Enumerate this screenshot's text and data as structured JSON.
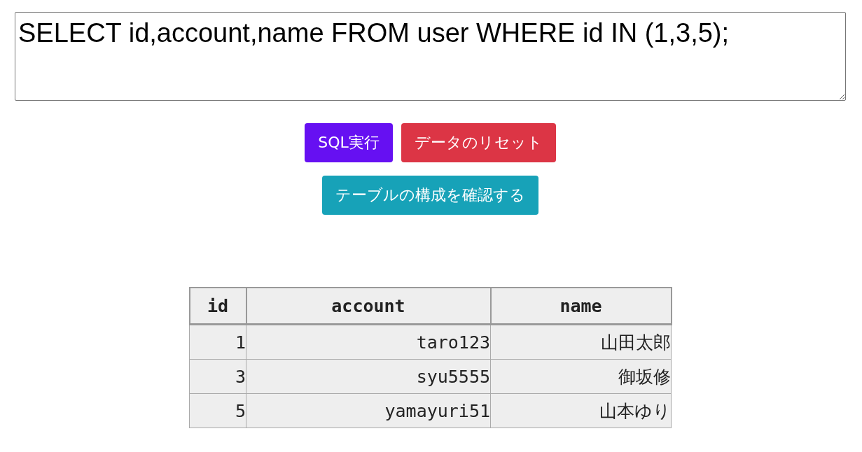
{
  "query": {
    "value": "SELECT id,account,name FROM user WHERE id IN (1,3,5);"
  },
  "buttons": [
    {
      "label": "SQL実行",
      "kind": "primary"
    },
    {
      "label": "データのリセット",
      "kind": "danger"
    },
    {
      "label": "テーブルの構成を確認する",
      "kind": "info"
    }
  ],
  "table": {
    "columns": [
      "id",
      "account",
      "name"
    ],
    "rows": [
      [
        "1",
        "taro123",
        "山田太郎"
      ],
      [
        "3",
        "syu5555",
        "御坂修"
      ],
      [
        "5",
        "yamayuri51",
        "山本ゆり"
      ]
    ]
  }
}
